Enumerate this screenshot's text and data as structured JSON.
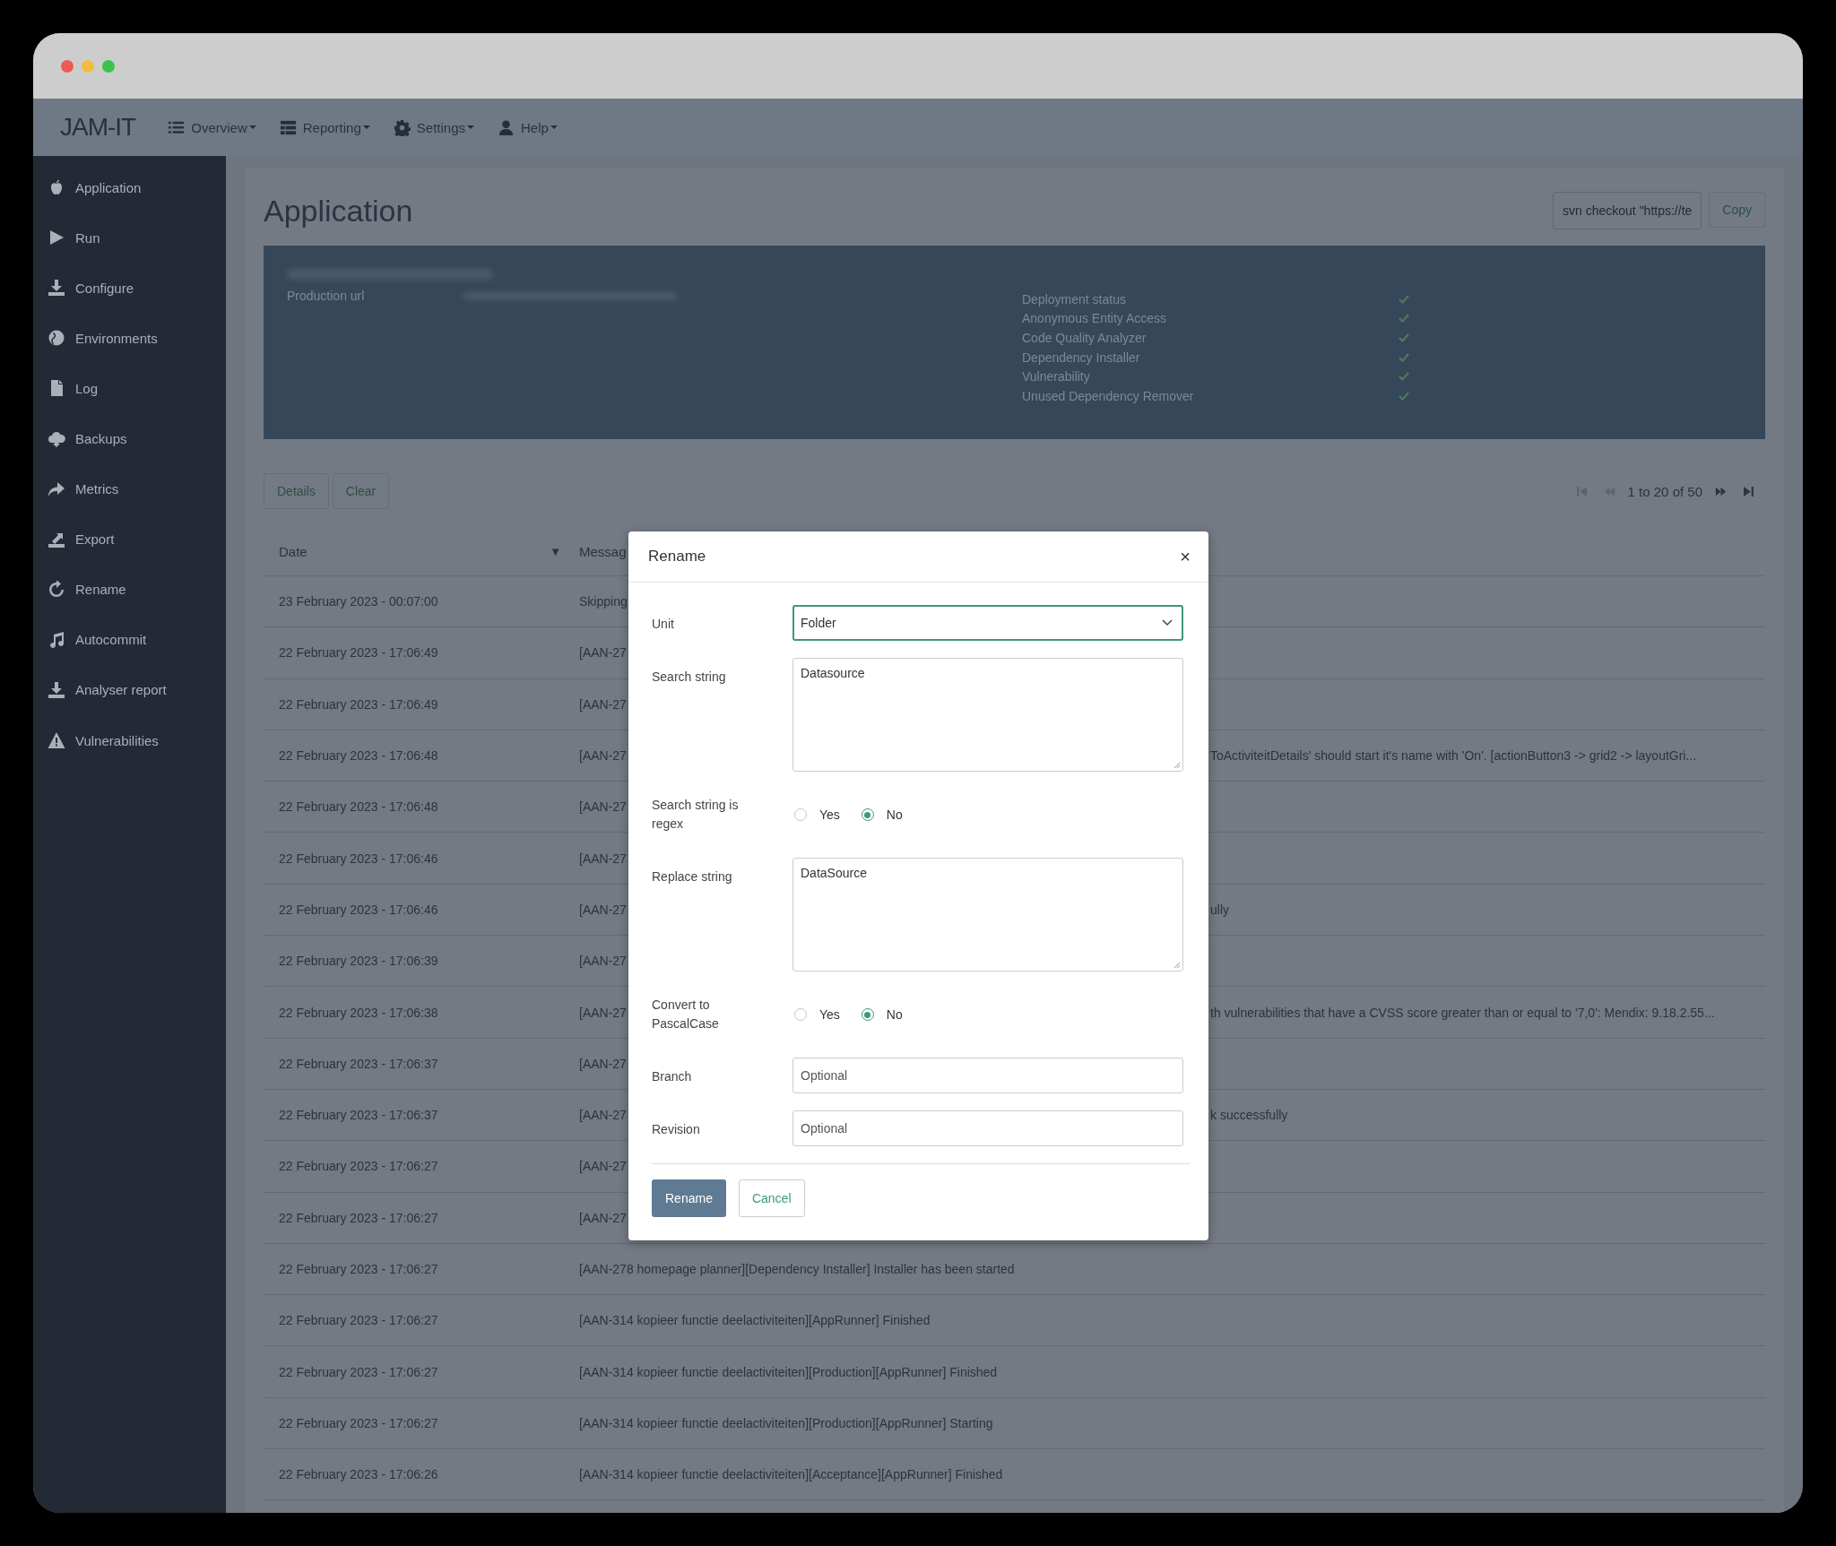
{
  "navbar": {
    "logo": "JAM-IT",
    "menus": [
      {
        "label": "Overview",
        "kind": "list"
      },
      {
        "label": "Reporting",
        "kind": "table"
      },
      {
        "label": "Settings",
        "kind": "gear"
      },
      {
        "label": "Help",
        "kind": "user"
      }
    ]
  },
  "sidebar": {
    "items": [
      {
        "label": "Application",
        "kind": "apple"
      },
      {
        "label": "Run",
        "kind": "play"
      },
      {
        "label": "Configure",
        "kind": "download"
      },
      {
        "label": "Environments",
        "kind": "globe"
      },
      {
        "label": "Log",
        "kind": "file"
      },
      {
        "label": "Backups",
        "kind": "cloud"
      },
      {
        "label": "Metrics",
        "kind": "share"
      },
      {
        "label": "Export",
        "kind": "upload"
      },
      {
        "label": "Rename",
        "kind": "refresh"
      },
      {
        "label": "Autocommit",
        "kind": "music"
      },
      {
        "label": "Analyser report",
        "kind": "download"
      },
      {
        "label": "Vulnerabilities",
        "kind": "warning"
      }
    ]
  },
  "page": {
    "title": "Application",
    "checkout_command": "svn checkout \"https://te",
    "copy_button": "Copy"
  },
  "summary": {
    "field_label": "Production url",
    "checks": [
      {
        "label": "Deployment status",
        "passed": true
      },
      {
        "label": "Anonymous Entity Access",
        "passed": true
      },
      {
        "label": "Code Quality Analyzer",
        "passed": true
      },
      {
        "label": "Dependency Installer",
        "passed": true
      },
      {
        "label": "Vulnerability",
        "passed": true
      },
      {
        "label": "Unused Dependency Remover",
        "passed": true
      }
    ]
  },
  "log": {
    "buttons": [
      "Details",
      "Clear"
    ],
    "pagination": "1 to 20 of 50",
    "columns": [
      "Date",
      "Messag"
    ],
    "sort_indicator": "▼",
    "rows": [
      {
        "date": "23 February 2023 - 00:07:00",
        "message_left": "Skipping"
      },
      {
        "date": "22 February 2023 - 17:06:49",
        "message_left": "[AAN-27"
      },
      {
        "date": "22 February 2023 - 17:06:49",
        "message_left": "[AAN-27"
      },
      {
        "date": "22 February 2023 - 17:06:48",
        "message_left": "[AAN-27",
        "message_right": "ToActiviteitDetails' should start it's name with 'On'. [actionButton3 -> grid2 -> layoutGri..."
      },
      {
        "date": "22 February 2023 - 17:06:48",
        "message_left": "[AAN-27"
      },
      {
        "date": "22 February 2023 - 17:06:46",
        "message_left": "[AAN-27"
      },
      {
        "date": "22 February 2023 - 17:06:46",
        "message_left": "[AAN-27",
        "message_right": "ully"
      },
      {
        "date": "22 February 2023 - 17:06:39",
        "message_left": "[AAN-27"
      },
      {
        "date": "22 February 2023 - 17:06:38",
        "message_left": "[AAN-27",
        "message_right": "th vulnerabilities that have a CVSS score greater than or equal to '7,0': Mendix: 9.18.2.55..."
      },
      {
        "date": "22 February 2023 - 17:06:37",
        "message_left": "[AAN-27"
      },
      {
        "date": "22 February 2023 - 17:06:37",
        "message_left": "[AAN-27",
        "message_right": "k successfully"
      },
      {
        "date": "22 February 2023 - 17:06:27",
        "message_left": "[AAN-27"
      },
      {
        "date": "22 February 2023 - 17:06:27",
        "message_left": "[AAN-27"
      },
      {
        "date": "22 February 2023 - 17:06:27",
        "message": "[AAN-278 homepage planner][Dependency Installer] Installer has been started"
      },
      {
        "date": "22 February 2023 - 17:06:27",
        "message": "[AAN-314 kopieer functie deelactiviteiten][AppRunner] Finished"
      },
      {
        "date": "22 February 2023 - 17:06:27",
        "message": "[AAN-314 kopieer functie deelactiviteiten][Production][AppRunner] Finished"
      },
      {
        "date": "22 February 2023 - 17:06:27",
        "message": "[AAN-314 kopieer functie deelactiviteiten][Production][AppRunner] Starting"
      },
      {
        "date": "22 February 2023 - 17:06:26",
        "message": "[AAN-314 kopieer functie deelactiviteiten][Acceptance][AppRunner] Finished"
      }
    ]
  },
  "dialog": {
    "title": "Rename",
    "close": "×",
    "fields": [
      {
        "kind": "select",
        "label": "Unit",
        "value": "Folder",
        "focused": true
      },
      {
        "kind": "textarea",
        "label": "Search string",
        "value": "Datasource"
      },
      {
        "kind": "radio",
        "label": "Search string is regex",
        "options": [
          {
            "label": "Yes",
            "selected": false
          },
          {
            "label": "No",
            "selected": true
          }
        ]
      },
      {
        "kind": "textarea",
        "label": "Replace string",
        "value": "DataSource"
      },
      {
        "kind": "radio",
        "label": "Convert to PascalCase",
        "options": [
          {
            "label": "Yes",
            "selected": false
          },
          {
            "label": "No",
            "selected": true
          }
        ]
      },
      {
        "kind": "text",
        "label": "Branch",
        "placeholder": "Optional"
      },
      {
        "kind": "text",
        "label": "Revision",
        "placeholder": "Optional"
      }
    ],
    "primary_button": "Rename",
    "cancel_button": "Cancel"
  }
}
